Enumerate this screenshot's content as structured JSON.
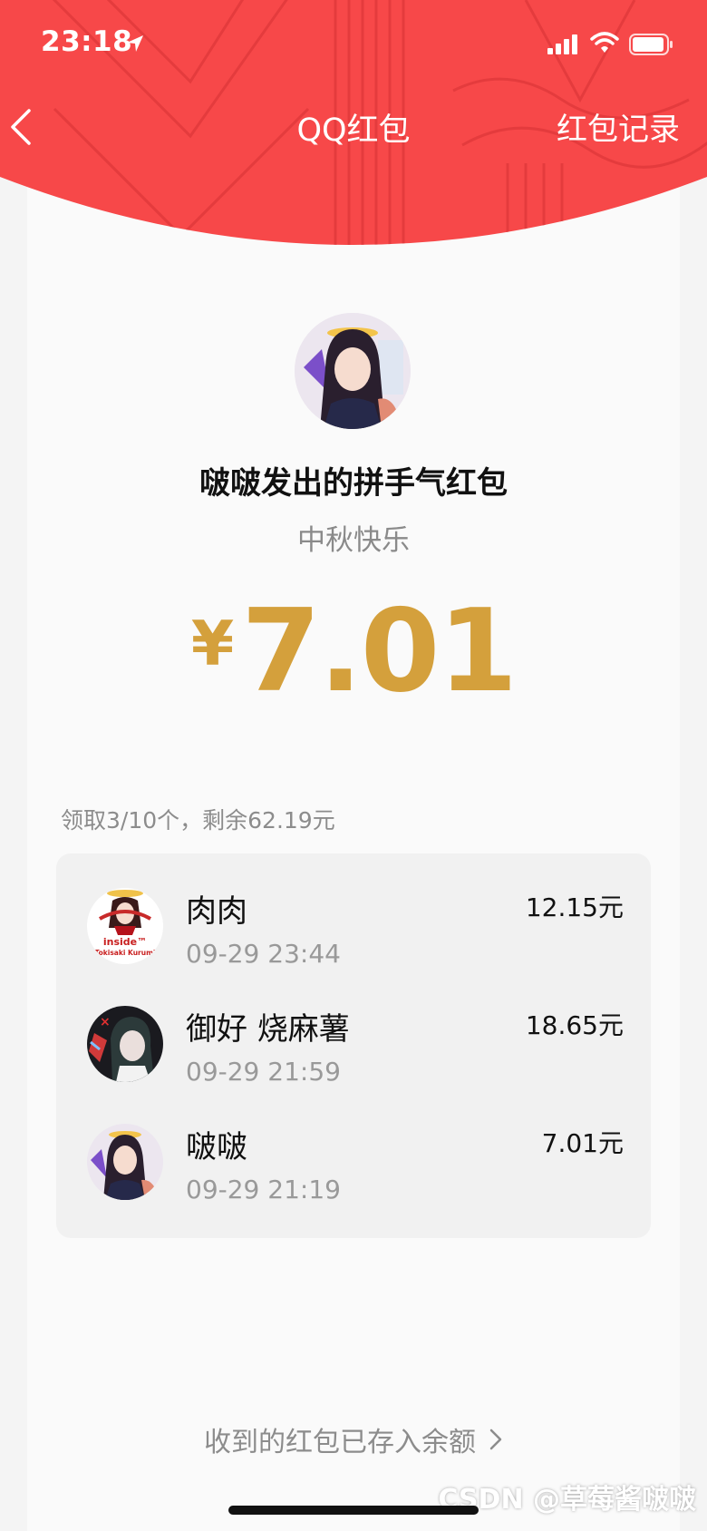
{
  "status_bar": {
    "time": "23:18"
  },
  "nav": {
    "title": "QQ红包",
    "right_label": "红包记录"
  },
  "packet": {
    "title": "啵啵发出的拼手气红包",
    "blessing": "中秋快乐",
    "currency": "¥",
    "amount": "7.01"
  },
  "summary": "领取3/10个，剩余62.19元",
  "claims": [
    {
      "name": "肉肉",
      "time": "09-29 23:44",
      "amount": "12.15元",
      "avatar_text_1": "inside™",
      "avatar_text_2": "Tokisaki Kurumi"
    },
    {
      "name": "御好 烧麻薯",
      "time": "09-29 21:59",
      "amount": "18.65元"
    },
    {
      "name": "啵啵",
      "time": "09-29 21:19",
      "amount": "7.01元"
    }
  ],
  "footer": {
    "link": "收到的红包已存入余额",
    "watermark": "CSDN @草莓酱啵啵"
  },
  "colors": {
    "header_red": "#f74849",
    "amount_gold": "#d4a03c"
  },
  "icons": [
    "location-icon",
    "signal-icon",
    "wifi-icon",
    "battery-icon",
    "back-icon",
    "chevron-right-icon"
  ]
}
